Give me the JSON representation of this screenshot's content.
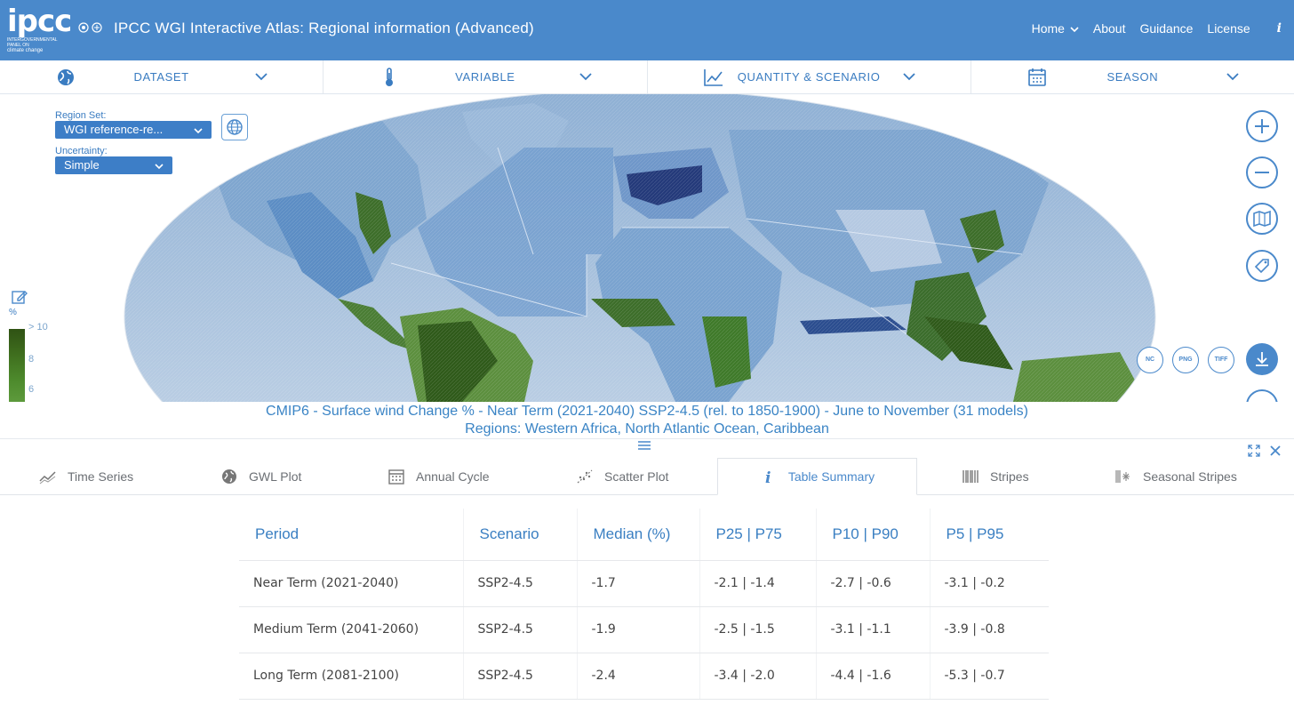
{
  "header": {
    "logo": "ipcc",
    "logo_sub1": "INTERGOVERNMENTAL PANEL ON",
    "logo_sub2": "climate change",
    "title": "IPCC WGI Interactive Atlas: Regional information (Advanced)",
    "nav": {
      "home": "Home",
      "about": "About",
      "guidance": "Guidance",
      "license": "License",
      "info": "i"
    }
  },
  "selectors": [
    {
      "label": "DATASET",
      "icon": "globe-icon"
    },
    {
      "label": "VARIABLE",
      "icon": "thermometer-icon"
    },
    {
      "label": "QUANTITY & SCENARIO",
      "icon": "line-chart-icon"
    },
    {
      "label": "SEASON",
      "icon": "calendar-icon"
    }
  ],
  "map": {
    "region_set_label": "Region Set:",
    "region_set_value": "WGI reference-re...",
    "uncertainty_label": "Uncertainty:",
    "uncertainty_value": "Simple",
    "legend_unit": "%",
    "legend_ticks": [
      "> 10",
      "8",
      "6"
    ],
    "downloads": [
      "NC",
      "PNG",
      "TIFF"
    ],
    "colors": {
      "land_green": "#2f5a1a",
      "ocean_blue": "#8fb2d8",
      "deep_blue": "#243a7a"
    }
  },
  "caption": {
    "line1": "CMIP6 - Surface wind Change % - Near Term (2021-2040) SSP2-4.5 (rel. to 1850-1900) - June to November (31 models)",
    "line2": "Regions: Western Africa, North Atlantic Ocean, Caribbean"
  },
  "tabs": [
    {
      "label": "Time Series",
      "icon": "time-series-icon"
    },
    {
      "label": "GWL Plot",
      "icon": "globe-icon"
    },
    {
      "label": "Annual Cycle",
      "icon": "calendar-icon"
    },
    {
      "label": "Scatter Plot",
      "icon": "scatter-icon"
    },
    {
      "label": "Table Summary",
      "icon": "info-icon",
      "active": true
    },
    {
      "label": "Stripes",
      "icon": "stripes-icon"
    },
    {
      "label": "Seasonal Stripes",
      "icon": "seasonal-stripes-icon"
    }
  ],
  "table": {
    "headers": [
      "Period",
      "Scenario",
      "Median (%)",
      "P25 | P75",
      "P10 | P90",
      "P5 | P95"
    ],
    "rows": [
      [
        "Near Term (2021-2040)",
        "SSP2-4.5",
        "-1.7",
        "-2.1 | -1.4",
        "-2.7 | -0.6",
        "-3.1 | -0.2"
      ],
      [
        "Medium Term (2041-2060)",
        "SSP2-4.5",
        "-1.9",
        "-2.5 | -1.5",
        "-3.1 | -1.1",
        "-3.9 | -0.8"
      ],
      [
        "Long Term (2081-2100)",
        "SSP2-4.5",
        "-2.4",
        "-3.4 | -2.0",
        "-4.4 | -1.6",
        "-5.3 | -0.7"
      ]
    ]
  }
}
